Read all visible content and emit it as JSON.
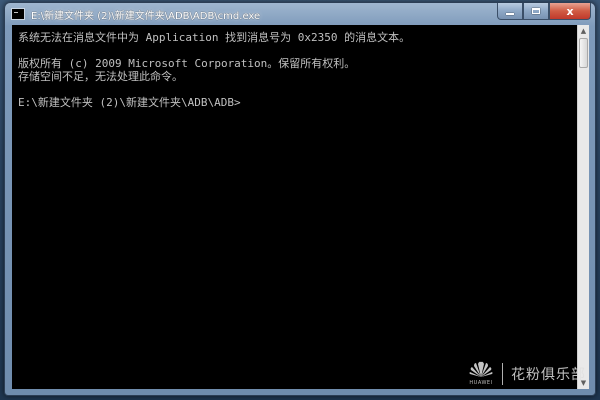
{
  "window": {
    "title": "E:\\新建文件夹 (2)\\新建文件夹\\ADB\\ADB\\cmd.exe",
    "controls": {
      "minimize": "minimize",
      "maximize": "maximize",
      "close": "x"
    }
  },
  "console": {
    "lines": [
      "系统无法在消息文件中为 Application 找到消息号为 0x2350 的消息文本。",
      "",
      "版权所有 (c) 2009 Microsoft Corporation。保留所有权利。",
      "存储空间不足，无法处理此命令。",
      "",
      "E:\\新建文件夹 (2)\\新建文件夹\\ADB\\ADB>"
    ]
  },
  "watermark": {
    "brand": "HUAWEI",
    "text": "花粉俱乐部"
  },
  "colors": {
    "console_bg": "#000000",
    "console_text": "#c0c0c0",
    "close_button": "#c0392b"
  }
}
